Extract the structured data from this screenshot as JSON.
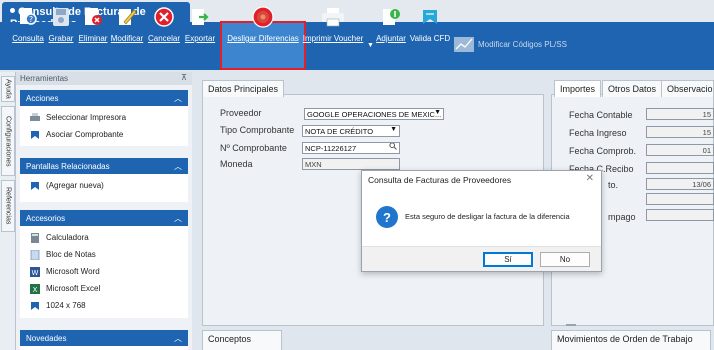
{
  "window": {
    "title": "Consulta de Facturas de Proveedores"
  },
  "toolbar": {
    "buttons": [
      {
        "label": "Consulta",
        "icon": "query-icon"
      },
      {
        "label": "Grabar",
        "icon": "save-icon"
      },
      {
        "label": "Eliminar",
        "icon": "delete-icon"
      },
      {
        "label": "Modificar",
        "icon": "edit-icon"
      },
      {
        "label": "Cancelar",
        "icon": "cancel-icon"
      },
      {
        "label": "Exportar",
        "icon": "export-icon"
      },
      {
        "label": "Desligar Diferencias",
        "icon": "unlink-icon"
      },
      {
        "label": "Imprimir Voucher",
        "icon": "printer-icon"
      },
      {
        "label": "Adjuntar",
        "icon": "attach-icon"
      },
      {
        "label": "Valida CFD",
        "icon": "validate-icon"
      }
    ],
    "extra_label": "Modificar Códigos PL/SS"
  },
  "side_tabs": [
    "Ayuda",
    "Configuraciones",
    "Referencias"
  ],
  "left_panel": {
    "header": "Herramientas",
    "pin": "⊼",
    "sections": [
      {
        "title": "Acciones",
        "items": [
          "Seleccionar Impresora",
          "Asociar Comprobante"
        ]
      },
      {
        "title": "Pantallas Relacionadas",
        "items": [
          "(Agregar nueva)"
        ]
      },
      {
        "title": "Accesorios",
        "items": [
          "Calculadora",
          "Bloc de Notas",
          "Microsoft Word",
          "Microsoft Excel",
          "1024 x 768"
        ]
      },
      {
        "title": "Novedades",
        "items": []
      }
    ]
  },
  "datos": {
    "tab": "Datos Principales",
    "proveedor_label": "Proveedor",
    "proveedor_value": "GOOGLE OPERACIONES DE MEXIC...",
    "tipo_label": "Tipo Comprobante",
    "tipo_value": "NOTA DE CRÉDITO",
    "numero_label": "Nº Comprobante",
    "numero_value": "NCP-11226127",
    "moneda_label": "Moneda",
    "moneda_value": "MXN"
  },
  "importes": {
    "tabs": [
      "Importes",
      "Otros Datos",
      "Observacio"
    ],
    "fields": [
      {
        "label": "Fecha Contable",
        "value": "15"
      },
      {
        "label": "Fecha Ingreso",
        "value": "15"
      },
      {
        "label": "Fecha Comprob.",
        "value": "01"
      },
      {
        "label": "Fecha C.Recibo",
        "value": ""
      },
      {
        "label": "to.",
        "value": "13/06"
      },
      {
        "label": "",
        "value": ""
      },
      {
        "label": "mpago",
        "value": ""
      }
    ]
  },
  "bottom_tabs": {
    "left": "Conceptos",
    "right": "Movimientos de Orden de Trabajo"
  },
  "dialog": {
    "title": "Consulta de Facturas de Proveedores",
    "close": "✕",
    "icon_glyph": "?",
    "message": "Esta seguro de desligar la factura de la diferencia",
    "yes": "Sí",
    "no": "No"
  },
  "colors": {
    "accent": "#1f64b0",
    "highlight": "#e0202a"
  }
}
